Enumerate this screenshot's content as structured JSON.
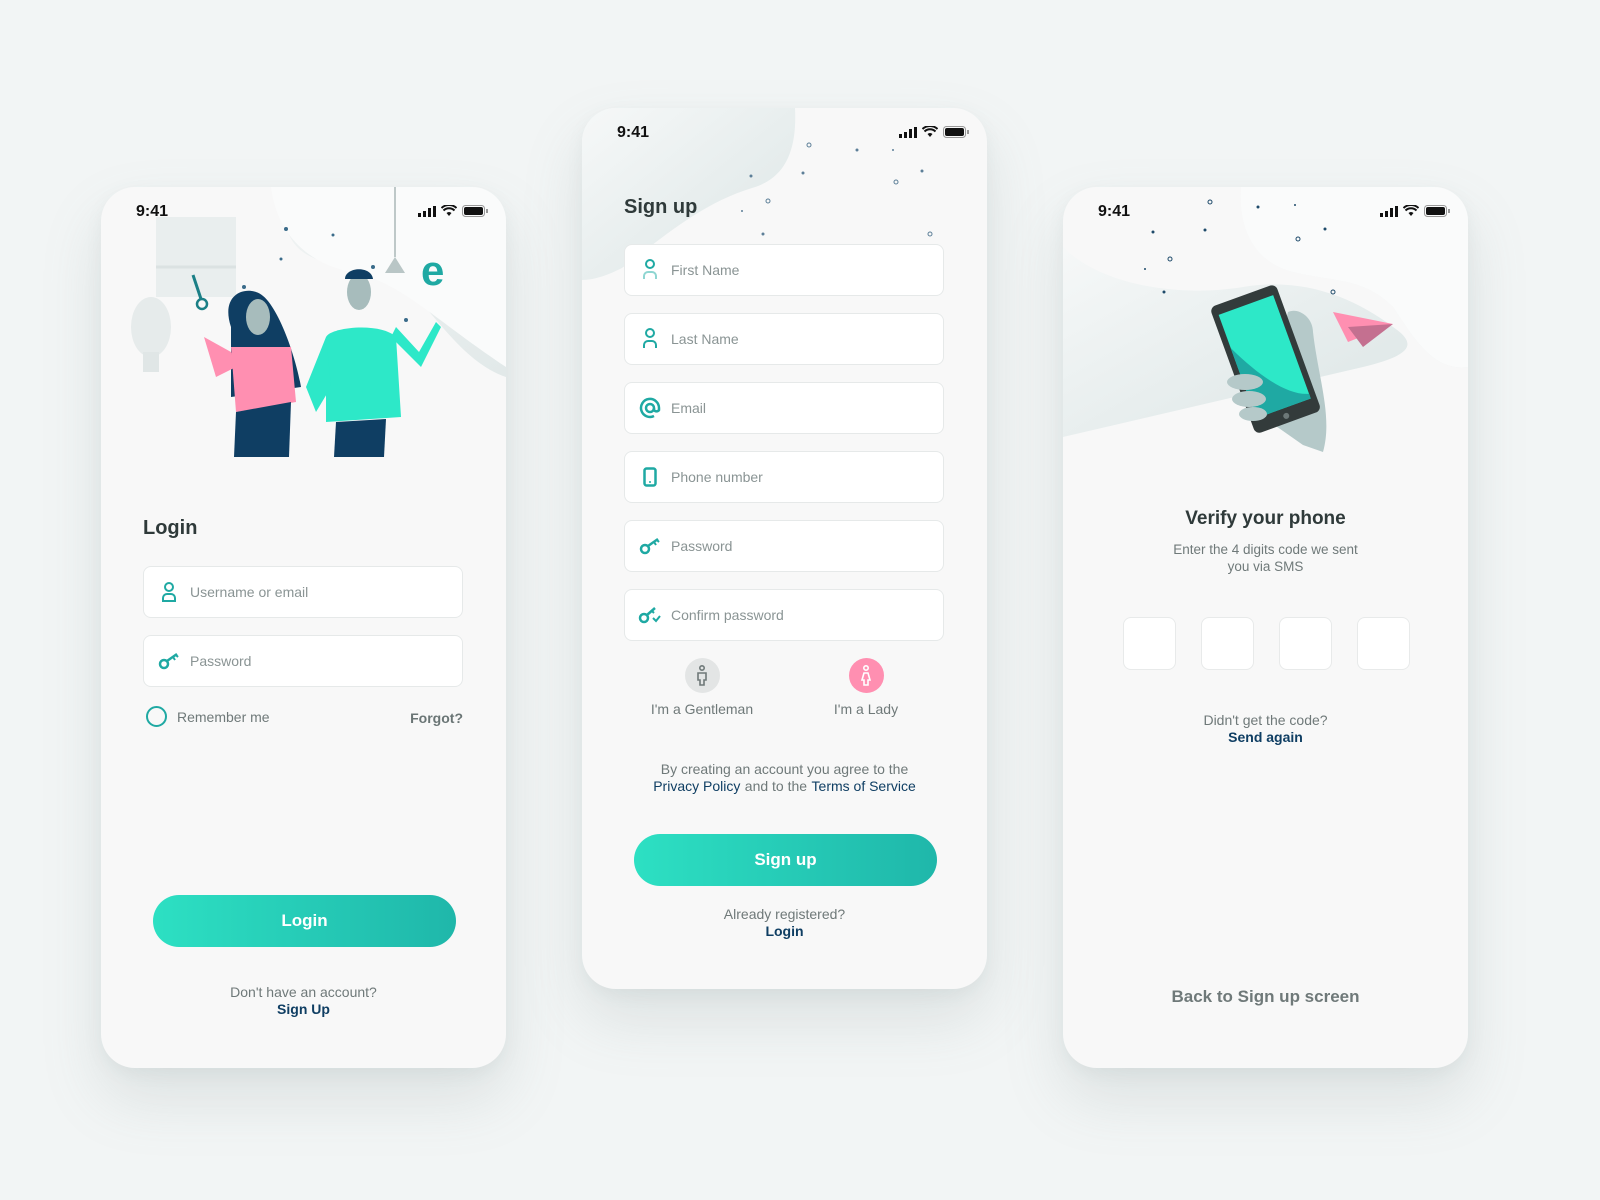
{
  "colors": {
    "accent_start": "#2de0c3",
    "accent_end": "#1fb7aa",
    "icon_teal": "#1fa9a3",
    "link_navy": "#0f3e63",
    "lady_pink": "#ff8fb1",
    "gentleman_gray": "#e3e5e5"
  },
  "status_bar": {
    "time": "9:41",
    "icons": [
      "signal-icon",
      "wifi-icon",
      "battery-icon"
    ]
  },
  "login": {
    "title": "Login",
    "username_placeholder": "Username or email",
    "password_placeholder": "Password",
    "remember_label": "Remember me",
    "forgot_label": "Forgot?",
    "login_button": "Login",
    "no_account_text": "Don't have an account?",
    "signup_link": "Sign Up"
  },
  "signup": {
    "title": "Sign up",
    "fields": [
      {
        "placeholder": "First Name",
        "icon": "user-icon"
      },
      {
        "placeholder": "Last Name",
        "icon": "user-icon"
      },
      {
        "placeholder": "Email",
        "icon": "at-icon"
      },
      {
        "placeholder": "Phone number",
        "icon": "phone-icon"
      },
      {
        "placeholder": "Password",
        "icon": "key-icon"
      },
      {
        "placeholder": "Confirm password",
        "icon": "key-check-icon"
      }
    ],
    "gender_options": [
      {
        "label": "I'm a Gentleman",
        "icon": "male-icon"
      },
      {
        "label": "I'm a Lady",
        "icon": "female-icon"
      }
    ],
    "terms_prefix": "By creating an account you agree to the",
    "privacy_link": "Privacy Policy",
    "terms_middle": "and to the",
    "terms_link": "Terms of Service",
    "signup_button": "Sign up",
    "already_text": "Already registered?",
    "login_link": "Login"
  },
  "verify": {
    "title": "Verify your phone",
    "subtitle_line1": "Enter the 4 digits code we sent",
    "subtitle_line2": "you via SMS",
    "code_digits": [
      "",
      "",
      "",
      ""
    ],
    "no_code_text": "Didn't get the code?",
    "send_again_link": "Send again",
    "back_link": "Back to Sign up screen"
  }
}
